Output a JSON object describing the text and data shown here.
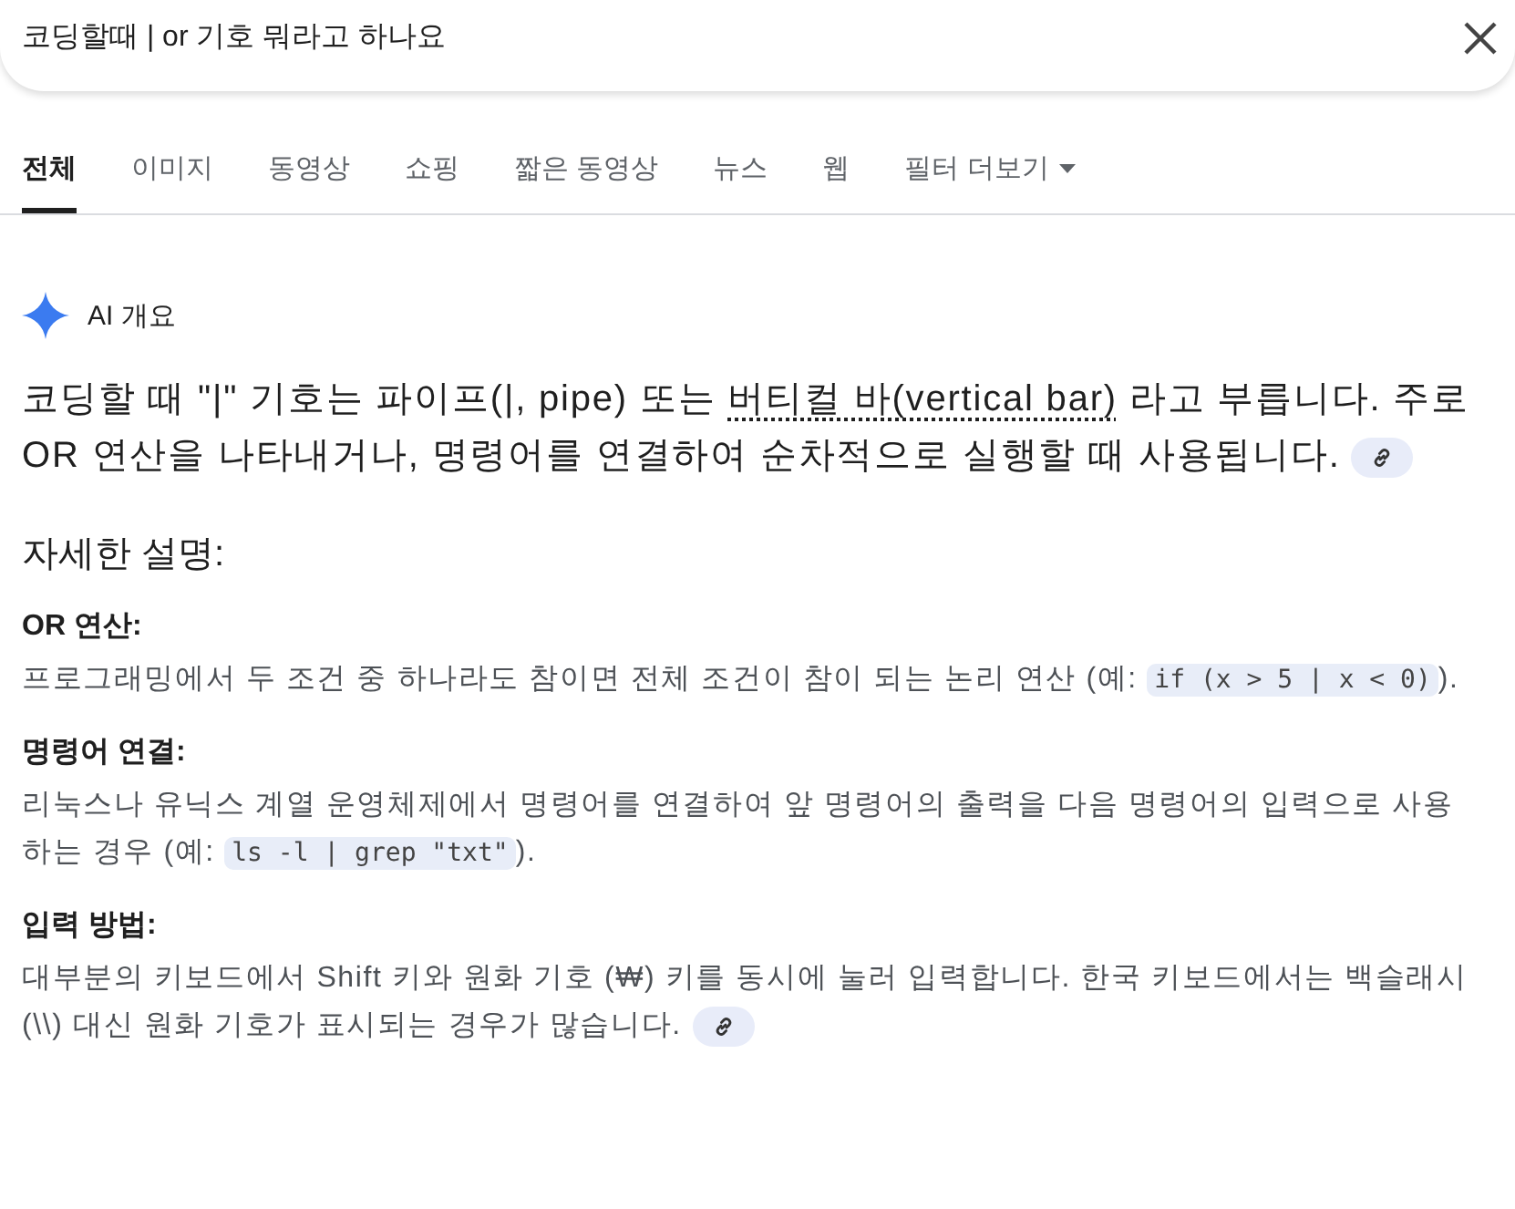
{
  "search": {
    "value": "코딩할때 | or 기호 뭐라고 하나요"
  },
  "tabs": [
    {
      "label": "전체",
      "selected": true
    },
    {
      "label": "이미지",
      "selected": false
    },
    {
      "label": "동영상",
      "selected": false
    },
    {
      "label": "쇼핑",
      "selected": false
    },
    {
      "label": "짧은 동영상",
      "selected": false
    },
    {
      "label": "뉴스",
      "selected": false
    },
    {
      "label": "웹",
      "selected": false
    },
    {
      "label": "필터 더보기",
      "selected": false,
      "kind": "menu"
    }
  ],
  "overview": {
    "title": "AI 개요",
    "summary": {
      "segments": [
        {
          "kind": "text",
          "text": "코딩할 때 \"|\" 기호는 파이프(|, pipe) 또는 "
        },
        {
          "kind": "term",
          "text": "버티컬 바(vertical bar)"
        },
        {
          "kind": "text",
          "text": " 라고 부릅니다. 주로 OR 연산을 나타내거나, 명령어를 연결하여 순차적으로 실행할 때 사용됩니다."
        }
      ],
      "link": true
    },
    "heading": "자세한 설명:",
    "sections": [
      {
        "title": "OR 연산:",
        "segments": [
          {
            "kind": "text",
            "text": "프로그래밍에서 두 조건 중 하나라도 참이면 전체 조건이 참이 되는 논리 연산 (예: "
          },
          {
            "kind": "code",
            "text": "if (x > 5 | x < 0)"
          },
          {
            "kind": "text",
            "text": ")."
          }
        ],
        "link": false
      },
      {
        "title": "명령어 연결:",
        "segments": [
          {
            "kind": "text",
            "text": "리눅스나 유닉스 계열 운영체제에서 명령어를 연결하여 앞 명령어의 출력을 다음 명령어의 입력으로 사용하는 경우 (예: "
          },
          {
            "kind": "code",
            "text": "ls -l | grep \"txt\""
          },
          {
            "kind": "text",
            "text": ")."
          }
        ],
        "link": false
      },
      {
        "title": "입력 방법:",
        "segments": [
          {
            "kind": "text",
            "text": "대부분의 키보드에서 Shift 키와 원화 기호 (₩) 키를 동시에 눌러 입력합니다. 한국 키보드에서는 백슬래시(\\\\) 대신 원화 기호가 표시되는 경우가 많습니다."
          }
        ],
        "link": true
      }
    ]
  }
}
